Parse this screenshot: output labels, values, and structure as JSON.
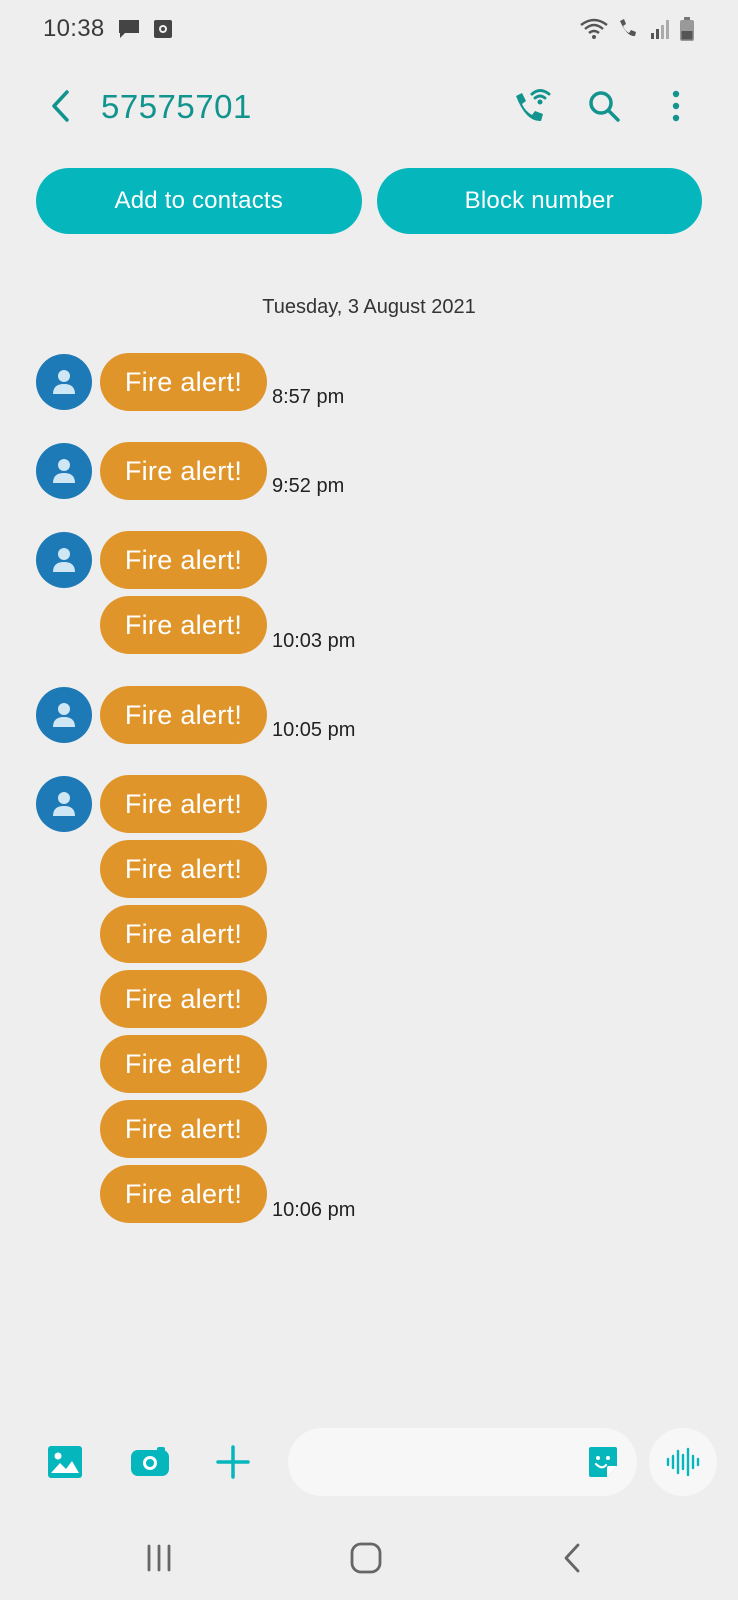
{
  "status_bar": {
    "time": "10:38",
    "icons": [
      "message-icon",
      "screen-record-icon",
      "wifi-icon",
      "wifi-call-icon",
      "signal-icon",
      "battery-icon"
    ]
  },
  "header": {
    "title": "57575701",
    "back_icon": "back-icon",
    "actions": [
      "wifi-call-icon",
      "search-icon",
      "more-options-icon"
    ]
  },
  "actions": {
    "add_contact": "Add to contacts",
    "block_number": "Block number"
  },
  "date_separator": "Tuesday, 3 August 2021",
  "messages": {
    "groups": [
      {
        "bubbles": [
          "Fire alert!"
        ],
        "time": "8:57 pm"
      },
      {
        "bubbles": [
          "Fire alert!"
        ],
        "time": "9:52 pm"
      },
      {
        "bubbles": [
          "Fire alert!",
          "Fire alert!"
        ],
        "time": "10:03 pm"
      },
      {
        "bubbles": [
          "Fire alert!"
        ],
        "time": "10:05 pm"
      },
      {
        "bubbles": [
          "Fire alert!",
          "Fire alert!",
          "Fire alert!",
          "Fire alert!",
          "Fire alert!",
          "Fire alert!",
          "Fire alert!"
        ],
        "time": "10:06 pm"
      }
    ]
  },
  "composer": {
    "placeholder": "",
    "icons": [
      "gallery-icon",
      "camera-icon",
      "add-icon",
      "sticker-icon",
      "voice-input-icon"
    ]
  },
  "nav_bar": {
    "icons": [
      "recent-apps-icon",
      "home-icon",
      "nav-back-icon"
    ]
  },
  "colors": {
    "accent": "#06b6bd",
    "title": "#11948e",
    "bubble": "#e0952a",
    "avatar": "#1d7ab6",
    "background": "#eeeeee"
  }
}
